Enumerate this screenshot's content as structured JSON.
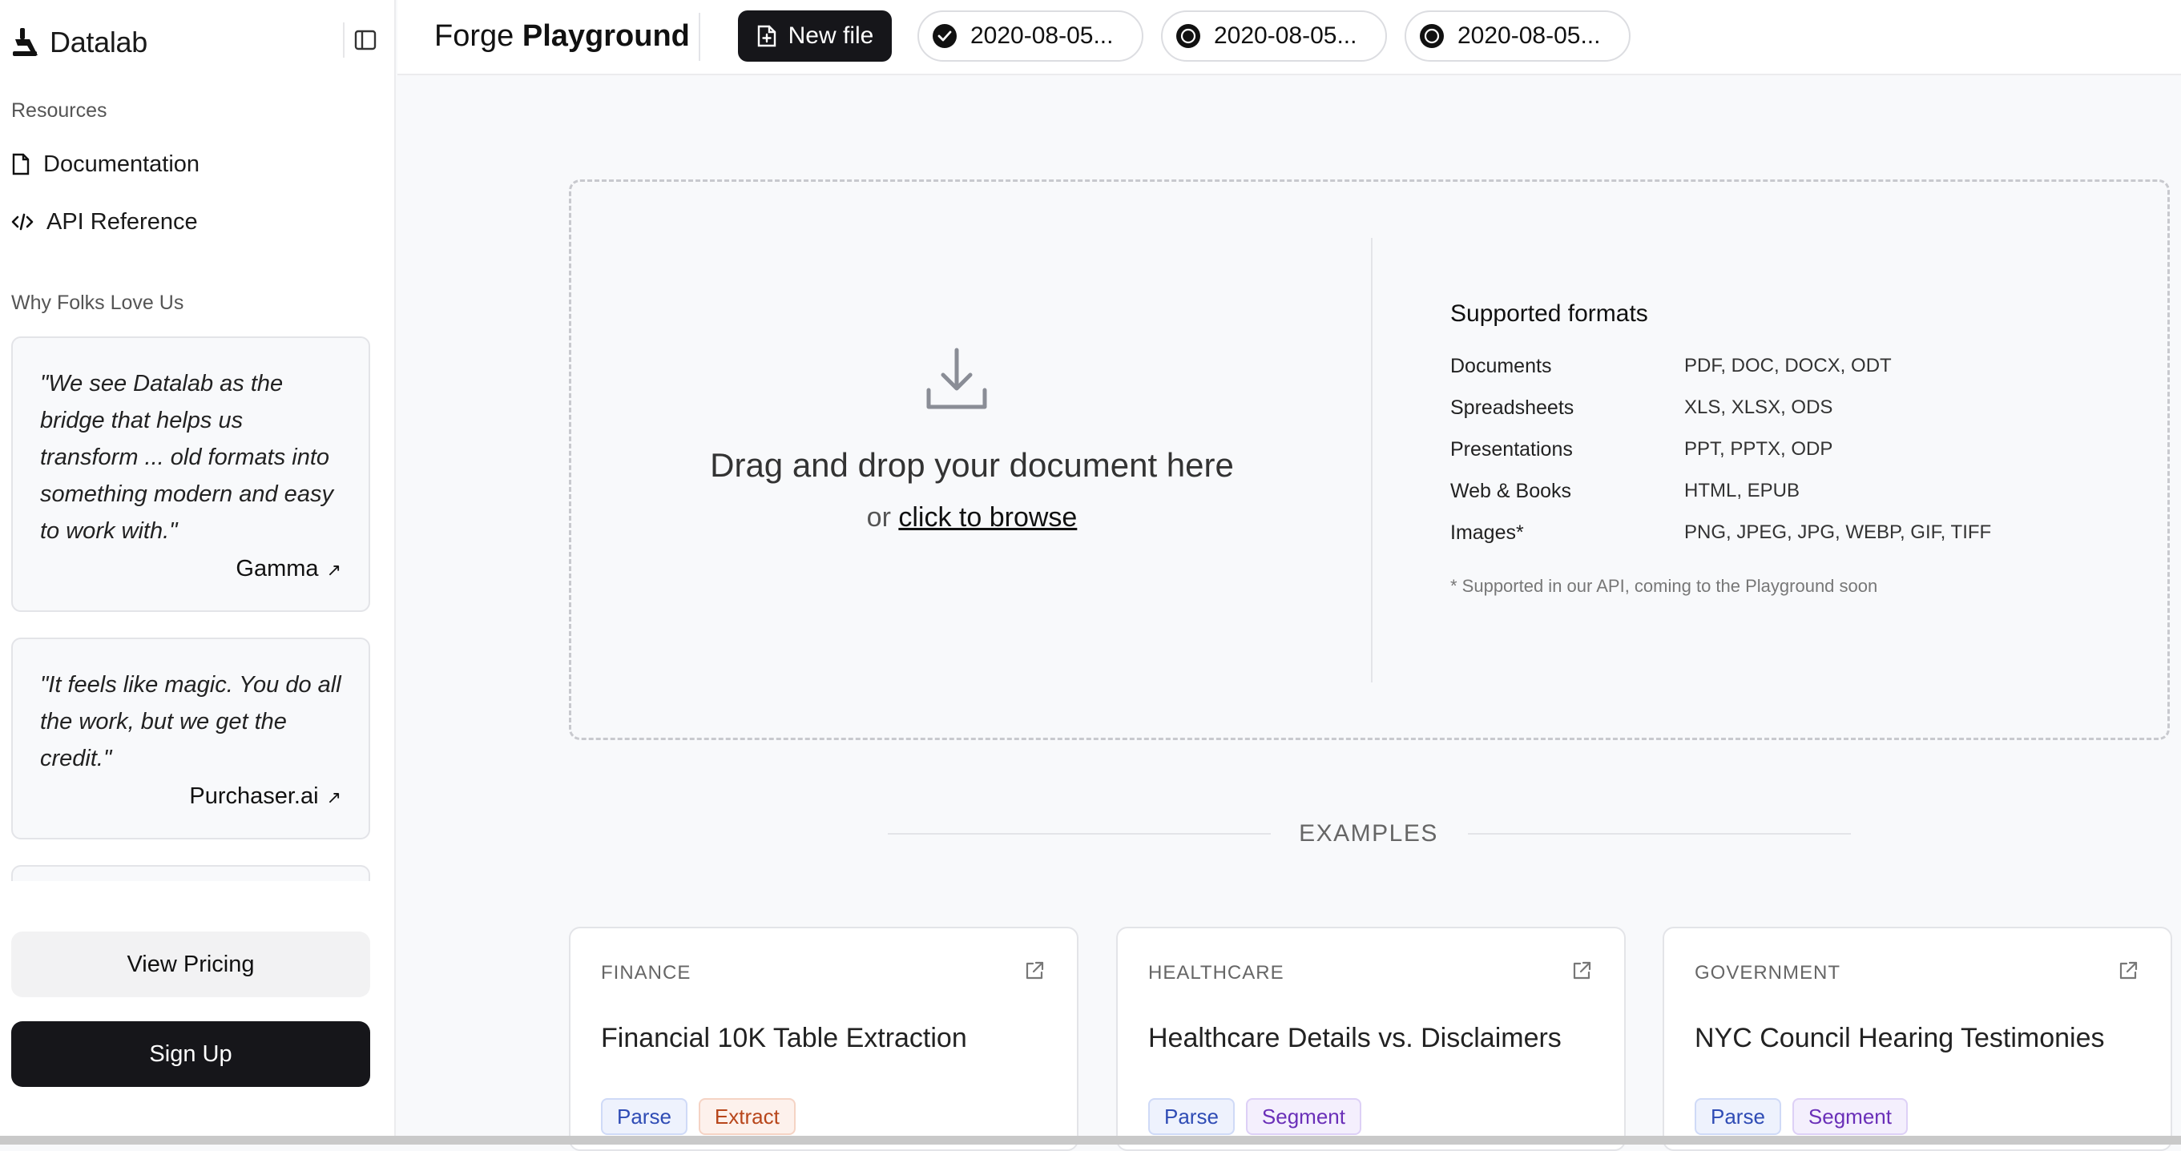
{
  "brand": {
    "name": "Datalab",
    "logo_icon": "datalab-logo-icon"
  },
  "sidebar": {
    "resources_title": "Resources",
    "nav": [
      {
        "label": "Documentation",
        "icon": "file-icon"
      },
      {
        "label": "API Reference",
        "icon": "code-icon"
      }
    ],
    "testimonials_title": "Why Folks Love Us",
    "testimonials": [
      {
        "quote": "\"We see Datalab as the bridge that helps us transform ... old formats into something modern and easy to work with.\"",
        "author": "Gamma"
      },
      {
        "quote": "\"It feels like magic. You do all the work, but we get the credit.\"",
        "author": "Purchaser.ai"
      }
    ],
    "pricing_label": "View Pricing",
    "signup_label": "Sign Up"
  },
  "header": {
    "title_light": "Forge",
    "title_bold": "Playground",
    "new_file_label": "New file",
    "files": [
      {
        "name": "2020-08-05...",
        "status_icon": "check-circle-icon"
      },
      {
        "name": "2020-08-05...",
        "status_icon": "pending-circle-icon"
      },
      {
        "name": "2020-08-05...",
        "status_icon": "pending-circle-icon"
      }
    ]
  },
  "dropzone": {
    "title": "Drag and drop your document here",
    "or_text": "or",
    "browse_label": "click to browse"
  },
  "formats": {
    "title": "Supported formats",
    "rows": [
      {
        "name": "Documents",
        "exts": "PDF, DOC, DOCX, ODT"
      },
      {
        "name": "Spreadsheets",
        "exts": "XLS, XLSX, ODS"
      },
      {
        "name": "Presentations",
        "exts": "PPT, PPTX, ODP"
      },
      {
        "name": "Web & Books",
        "exts": "HTML, EPUB"
      },
      {
        "name": "Images*",
        "exts": "PNG, JPEG, JPG, WEBP, GIF, TIFF"
      }
    ],
    "note": "* Supported in our API, coming to the Playground soon"
  },
  "examples": {
    "label": "EXAMPLES",
    "cards": [
      {
        "category": "FINANCE",
        "title": "Financial 10K Table Extraction",
        "tags": [
          "Parse",
          "Extract"
        ]
      },
      {
        "category": "HEALTHCARE",
        "title": "Healthcare Details vs. Disclaimers",
        "tags": [
          "Parse",
          "Segment"
        ]
      },
      {
        "category": "GOVERNMENT",
        "title": "NYC Council Hearing Testimonies",
        "tags": [
          "Parse",
          "Segment"
        ]
      }
    ]
  },
  "colors": {
    "primary_dark": "#16161a",
    "parse": "#2f4cb5",
    "extract": "#b8461b",
    "segment": "#6a2fb8"
  }
}
